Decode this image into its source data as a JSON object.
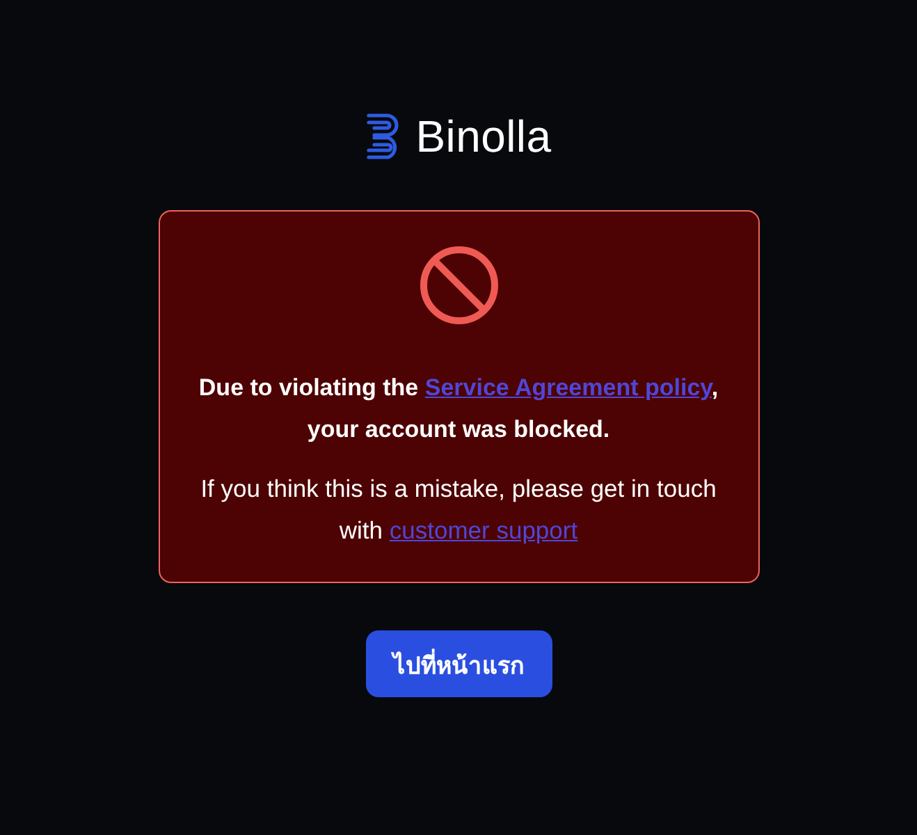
{
  "logo": {
    "name": "Binolla"
  },
  "alert": {
    "message": [
      {
        "kind": "text",
        "text": "Due to violating the "
      },
      {
        "kind": "link",
        "text": "Service Agreement policy"
      },
      {
        "kind": "text",
        "text": ", your account was blocked."
      }
    ],
    "note": [
      {
        "kind": "text",
        "text": "If you think this is a mistake, please get in touch with "
      },
      {
        "kind": "link",
        "text": "customer support"
      }
    ]
  },
  "button": {
    "label": "ไปที่หน้าแรก"
  }
}
